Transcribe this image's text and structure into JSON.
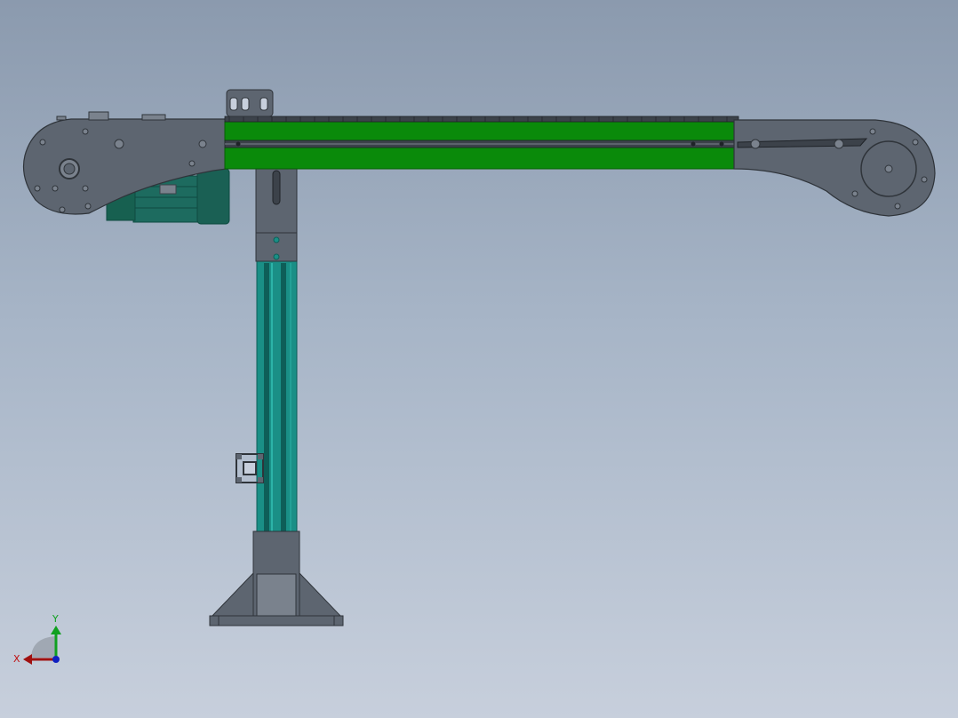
{
  "view": {
    "background_top": "#8b9aae",
    "background_bottom": "#c7cfdc"
  },
  "colors": {
    "belt": "#0a8a0a",
    "belt_dark": "#067006",
    "steel": "#5d6570",
    "steel_dark": "#3c424a",
    "steel_light": "#7a828d",
    "motor": "#1d6b5f",
    "motor_dark": "#0f4a41",
    "leg": "#1a8f86",
    "leg_dark": "#0e5e58",
    "axis_x": "#c01010",
    "axis_y": "#10a020",
    "axis_z": "#1020c0"
  },
  "triad": {
    "x_label": "X",
    "y_label": "Y"
  }
}
